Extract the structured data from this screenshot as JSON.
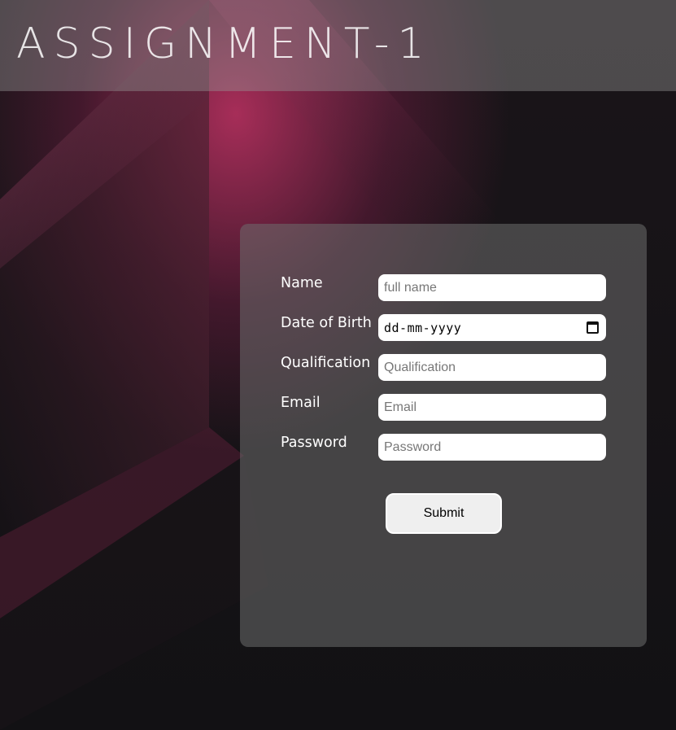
{
  "header": {
    "title": "ASSIGNMENT-1"
  },
  "form": {
    "fields": [
      {
        "label": "Name",
        "placeholder": "full name",
        "type": "text"
      },
      {
        "label": "Date of Birth",
        "display_value": "dd-mm-yyyy",
        "type": "date"
      },
      {
        "label": "Qualification",
        "placeholder": "Qualification",
        "type": "text"
      },
      {
        "label": "Email",
        "placeholder": "Email",
        "type": "email"
      },
      {
        "label": "Password",
        "placeholder": "Password",
        "type": "password"
      }
    ],
    "submit_label": "Submit"
  },
  "colors": {
    "accent_pink": "#d6366e",
    "background": "#131215",
    "card": "#6e6e6e"
  },
  "icons": {
    "date_picker": "calendar-icon"
  }
}
